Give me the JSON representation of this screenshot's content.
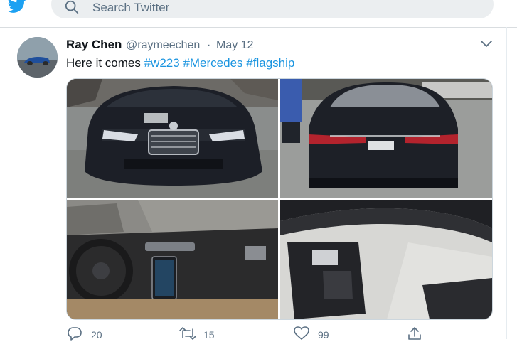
{
  "header": {
    "search_placeholder": "Search Twitter"
  },
  "tweet": {
    "display_name": "Ray Chen",
    "handle": "@raymeechen",
    "separator": "·",
    "date": "May 12",
    "text_prefix": "Here it comes ",
    "hashtags": [
      "#w223",
      "#Mercedes",
      "#flagship"
    ],
    "media_count": 4,
    "replies": "20",
    "retweets": "15",
    "likes": "99"
  },
  "colors": {
    "brand": "#1da1f2",
    "hashtag": "#1b95e0",
    "muted_text": "#5b7083",
    "search_bg": "#ebeef0"
  },
  "icons": {
    "logo": "twitter-bird-icon",
    "search": "search-icon",
    "more": "chevron-down-icon",
    "reply": "reply-icon",
    "retweet": "retweet-icon",
    "like": "heart-icon",
    "share": "share-icon"
  }
}
